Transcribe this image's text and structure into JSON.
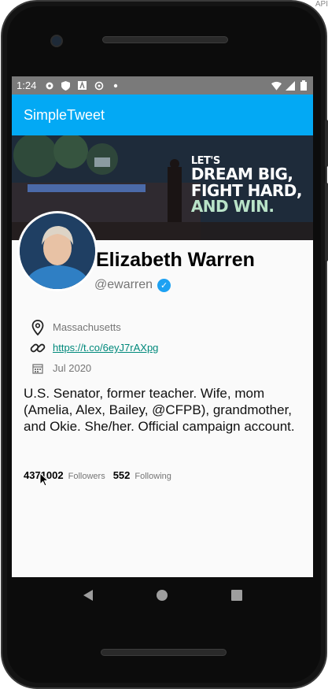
{
  "status_bar": {
    "time": "1:24",
    "icons_left": [
      "gear-icon",
      "shield-icon",
      "a-icon",
      "sync-icon",
      "dot-icon"
    ],
    "icons_right": [
      "wifi-icon",
      "signal-icon",
      "battery-icon"
    ]
  },
  "app_bar": {
    "title": "SimpleTweet"
  },
  "banner": {
    "line1": "LET'S",
    "line2": "DREAM BIG,",
    "line3": "FIGHT HARD,",
    "line4": "AND WIN."
  },
  "profile": {
    "name": "Elizabeth Warren",
    "handle": "@ewarren",
    "verified": true,
    "location": "Massachusetts",
    "url": "https://t.co/6eyJ7rAXpg",
    "joined": "Jul 2020",
    "bio": "U.S. Senator, former teacher. Wife, mom (Amelia, Alex, Bailey, @CFPB), grandmother, and Okie. She/her. Official campaign account.",
    "followers_count": "4371002",
    "followers_label": "Followers",
    "following_count": "552",
    "following_label": "Following"
  },
  "corner_text": "API",
  "colors": {
    "app_bar": "#03a9f4",
    "link": "#00897b",
    "verified": "#1da1f2"
  }
}
